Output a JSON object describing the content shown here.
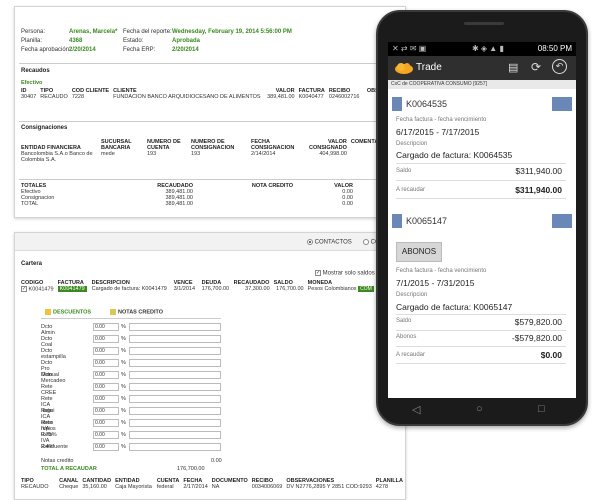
{
  "report_top": {
    "persona_label": "Persona:",
    "persona_value": "Arenas, Marcela*",
    "planilla_label": "Planilla:",
    "planilla_value": "4368",
    "fecha_aprob_label": "Fecha aprobación:",
    "fecha_aprob_value": "2/20/2014",
    "fecha_reporte_label": "Fecha del reporte:",
    "fecha_reporte_value": "Wednesday, February 19, 2014 5:56:00 PM",
    "estado_label": "Estado:",
    "estado_value": "Aprobada",
    "fecha_erp_label": "Fecha ERP:",
    "fecha_erp_value": "2/20/2014",
    "recaudos_title": "Recaudos",
    "efectivo_label": "Efectivo",
    "recaudos_headers": [
      "ID",
      "TIPO",
      "COD CLIENTE",
      "CLIENTE",
      "VALOR",
      "FACTURA",
      "RECIBO",
      "OBSERVA"
    ],
    "recaudos_row": [
      "30407",
      "RECAUDO",
      "7228",
      "FUNDACION BANCO ARQUIDIOCESANO DE ALIMENTOS",
      "389,481.00",
      "K0040477",
      "0246002716",
      ""
    ],
    "consignaciones_title": "Consignaciones",
    "consig_headers": [
      "ENTIDAD FINANCIERA",
      "SUCURSAL BANCARIA",
      "NUMERO DE CUENTA",
      "NUMERO DE CONSIGNACION",
      "FECHA CONSIGNACION",
      "VALOR CONSIGNADO",
      "COMENTA"
    ],
    "consig_row": [
      "Bancolombia S.A.o Banco de Colombia S.A.",
      "mede",
      "193",
      "193",
      "2/14/2014",
      "404,998.00",
      ""
    ],
    "totales_headers": [
      "TOTALES",
      "RECAUDADO",
      "NOTA CREDITO",
      "VALOR"
    ],
    "totales_rows": [
      [
        "Efectivo",
        "389,481.00",
        "",
        "0.00"
      ],
      [
        "Consignacion",
        "389,481.00",
        "",
        "0.00"
      ],
      [
        "TOTAL",
        "389,481.00",
        "",
        "0.00"
      ]
    ]
  },
  "report_bottom": {
    "tab_contactos": "CONTACTOS",
    "tab_com": "CO",
    "cartera_title": "Cartera",
    "mostrar_label": "Mostrar solo saldos",
    "cartera_headers": [
      "CODIGO",
      "FACTURA",
      "DESCRIPCION",
      "VENCE",
      "DEUDA",
      "RECAUDADO",
      "SALDO",
      "MONEDA"
    ],
    "cartera_row": [
      "K0041479",
      "K0041479",
      "Cargado de factura: K0041479",
      "3/1/2014",
      "176,700.00",
      "37,300.00",
      "176,700.00",
      "Pesos Colombianos"
    ],
    "cartera_action": "COM",
    "tab_descuentos": "DESCUENTOS",
    "tab_notas": "NOTAS CREDITO",
    "discount_rows": [
      {
        "label": "Dcto Almin",
        "value": "0.00"
      },
      {
        "label": "Dcto Coal",
        "value": "0.00"
      },
      {
        "label": "Dcto estampilla",
        "value": "0.00"
      },
      {
        "label": "Dcto Pro Manual",
        "value": "0.00"
      },
      {
        "label": "Dcto Mercadeo",
        "value": "0.00"
      },
      {
        "label": "Rete CREE",
        "value": "0.00"
      },
      {
        "label": "Rete ICA Itagui",
        "value": "0.00"
      },
      {
        "label": "Rete ICA otros mpios",
        "value": "0.00"
      },
      {
        "label": "Rete IVA 0.75%",
        "value": "0.00"
      },
      {
        "label": "Rete IVA 2.4%",
        "value": "0.00"
      },
      {
        "label": "Retefuente",
        "value": "0.00"
      }
    ],
    "percent_symbol": "%",
    "notas_label": "Notas credito",
    "notas_value": "0.00",
    "total_label": "TOTAL A RECAUDAR",
    "total_value": "176,700.00",
    "pagos_headers": [
      "TIPO",
      "CANAL",
      "CANTIDAD",
      "ENTIDAD",
      "CUENTA",
      "FECHA",
      "DOCUMENTO",
      "RECIBO",
      "OBSERVACIONES",
      "PLANILLA"
    ],
    "pagos_row": [
      "RECAUDO",
      "Cheque",
      "35,160.00",
      "Caja Mayorista",
      "federal",
      "2/17/2014",
      "NA",
      "0034006069",
      "DV N2776,2895 Y 2851 COD:9293",
      "4278"
    ]
  },
  "phone": {
    "status_time": "08:50 PM",
    "app_title": "Trade",
    "subbar_text": "CxC de COOPERATIVA CONSUMO [9257]",
    "card1": {
      "code": "K0064535",
      "fecha_label": "Fecha factura - fecha vencimiento",
      "fecha_value": "6/17/2015 - 7/17/2015",
      "desc_label": "Descripcion",
      "desc_value": "Cargado de factura: K0064535",
      "saldo_label": "Saldo",
      "saldo_value": "$311,940.00",
      "recaudar_label": "A recaudar",
      "recaudar_value": "$311,940.00"
    },
    "card2": {
      "code": "K0065147",
      "abonos_button": "ABONOS",
      "fecha_label": "Fecha factura - fecha vencimiento",
      "fecha_value": "7/1/2015 - 7/31/2015",
      "desc_label": "Descripcion",
      "desc_value": "Cargado de factura: K0065147",
      "saldo_label": "Saldo",
      "saldo_value": "$579,820.00",
      "abonos_label": "Abonos",
      "abonos_value": "-$579,820.00",
      "recaudar_label": "A recaudar",
      "recaudar_value": "$0.00"
    }
  },
  "colors": {
    "accent_green": "#3a8a1e",
    "card_header_blue": "#6a87b7",
    "app_bar": "#2f2f2f",
    "logo_orange": "#f5a623"
  }
}
